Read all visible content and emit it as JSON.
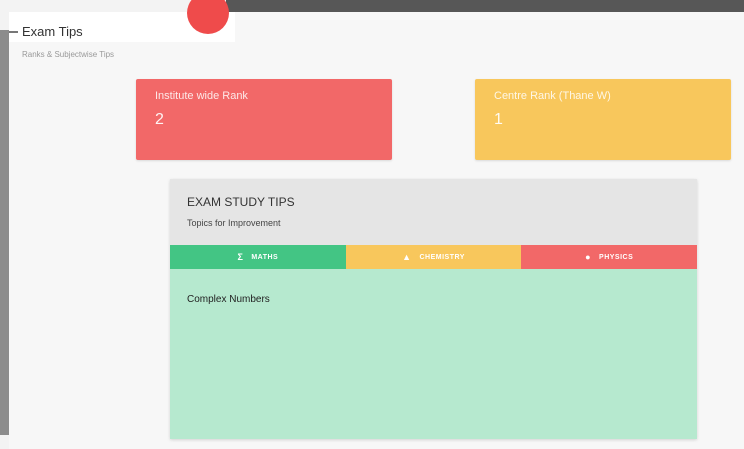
{
  "header": {
    "title": "Exam Tips",
    "subtitle": "Ranks & Subjectwise Tips"
  },
  "stats": {
    "institute_rank": {
      "label": "Institute wide Rank",
      "value": "2",
      "color": "#f26868"
    },
    "centre_rank": {
      "label": "Centre Rank (Thane W)",
      "value": "1",
      "color": "#f8c75c"
    }
  },
  "tips": {
    "title": "EXAM STUDY TIPS",
    "subtitle": "Topics for Improvement",
    "tabs": [
      {
        "label": "MATHS",
        "icon": "sigma-icon",
        "color": "#43c584"
      },
      {
        "label": "CHEMISTRY",
        "icon": "flask-icon",
        "color": "#f8c75c"
      },
      {
        "label": "PHYSICS",
        "icon": "atom-icon",
        "color": "#f26868"
      }
    ],
    "active_tab": "MATHS",
    "topics": [
      "Complex Numbers"
    ],
    "panel_color": "#b6e9cf"
  },
  "fab": {
    "icon": "add-icon",
    "color": "#ef4b4b"
  }
}
